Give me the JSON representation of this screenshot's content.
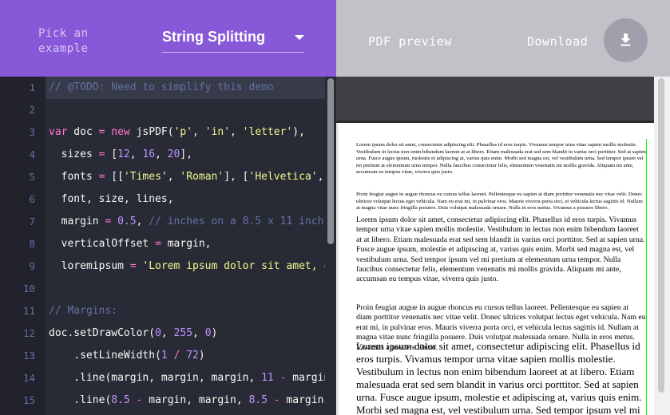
{
  "header": {
    "pick_label": "Pick an\nexample",
    "selected_example": "String Splitting",
    "preview_label": "PDF preview",
    "download_label": "Download"
  },
  "icons": {
    "select_arrow": "triangle-down-icon",
    "download": "download-arrow-icon"
  },
  "colors": {
    "accent_purple": "#8759d8",
    "preview_header": "#c4c0c8",
    "editor_bg": "#282a36",
    "pdf_margin_line": "#00ff00"
  },
  "editor": {
    "line_numbers": [
      "1",
      "2",
      "3",
      "4",
      "5",
      "6",
      "7",
      "8",
      "9",
      "10",
      "11",
      "12",
      "13",
      "14",
      "15"
    ],
    "lines": [
      [
        {
          "t": "comment",
          "v": "// @TODO: Need to simplify this demo"
        }
      ],
      [],
      [
        {
          "t": "kw",
          "v": "var"
        },
        {
          "t": "txt",
          "v": " doc "
        },
        {
          "t": "kw",
          "v": "="
        },
        {
          "t": "txt",
          "v": " "
        },
        {
          "t": "kw",
          "v": "new"
        },
        {
          "t": "txt",
          "v": " jsPDF("
        },
        {
          "t": "str",
          "v": "'p'"
        },
        {
          "t": "txt",
          "v": ", "
        },
        {
          "t": "str",
          "v": "'in'"
        },
        {
          "t": "txt",
          "v": ", "
        },
        {
          "t": "str",
          "v": "'letter'"
        },
        {
          "t": "txt",
          "v": "),"
        }
      ],
      [
        {
          "t": "txt",
          "v": "  sizes "
        },
        {
          "t": "kw",
          "v": "="
        },
        {
          "t": "txt",
          "v": " ["
        },
        {
          "t": "num",
          "v": "12"
        },
        {
          "t": "txt",
          "v": ", "
        },
        {
          "t": "num",
          "v": "16"
        },
        {
          "t": "txt",
          "v": ", "
        },
        {
          "t": "num",
          "v": "20"
        },
        {
          "t": "txt",
          "v": "],"
        }
      ],
      [
        {
          "t": "txt",
          "v": "  fonts "
        },
        {
          "t": "kw",
          "v": "="
        },
        {
          "t": "txt",
          "v": " [["
        },
        {
          "t": "str",
          "v": "'Times'"
        },
        {
          "t": "txt",
          "v": ", "
        },
        {
          "t": "str",
          "v": "'Roman'"
        },
        {
          "t": "txt",
          "v": "], ["
        },
        {
          "t": "str",
          "v": "'Helvetica'"
        },
        {
          "t": "txt",
          "v": ", "
        }
      ],
      [
        {
          "t": "txt",
          "v": "  font, size, lines,"
        }
      ],
      [
        {
          "t": "txt",
          "v": "  margin "
        },
        {
          "t": "kw",
          "v": "="
        },
        {
          "t": "txt",
          "v": " "
        },
        {
          "t": "num",
          "v": "0.5"
        },
        {
          "t": "txt",
          "v": ", "
        },
        {
          "t": "comment",
          "v": "// inches on a 8.5 x 11 inch"
        }
      ],
      [
        {
          "t": "txt",
          "v": "  verticalOffset "
        },
        {
          "t": "kw",
          "v": "="
        },
        {
          "t": "txt",
          "v": " margin,"
        }
      ],
      [
        {
          "t": "txt",
          "v": "  loremipsum "
        },
        {
          "t": "kw",
          "v": "="
        },
        {
          "t": "txt",
          "v": " "
        },
        {
          "t": "str",
          "v": "'Lorem ipsum dolor sit amet, c"
        }
      ],
      [],
      [
        {
          "t": "comment",
          "v": "// Margins:"
        }
      ],
      [
        {
          "t": "txt",
          "v": "doc.setDrawColor("
        },
        {
          "t": "num",
          "v": "0"
        },
        {
          "t": "txt",
          "v": ", "
        },
        {
          "t": "num",
          "v": "255"
        },
        {
          "t": "txt",
          "v": ", "
        },
        {
          "t": "num",
          "v": "0"
        },
        {
          "t": "txt",
          "v": ")"
        }
      ],
      [
        {
          "t": "txt",
          "v": "    .setLineWidth("
        },
        {
          "t": "num",
          "v": "1"
        },
        {
          "t": "txt",
          "v": " "
        },
        {
          "t": "kw",
          "v": "/"
        },
        {
          "t": "txt",
          "v": " "
        },
        {
          "t": "num",
          "v": "72"
        },
        {
          "t": "txt",
          "v": ")"
        }
      ],
      [
        {
          "t": "txt",
          "v": "    .line(margin, margin, margin, "
        },
        {
          "t": "num",
          "v": "11"
        },
        {
          "t": "txt",
          "v": " "
        },
        {
          "t": "kw",
          "v": "-"
        },
        {
          "t": "txt",
          "v": " margin"
        }
      ],
      [
        {
          "t": "txt",
          "v": "    .line("
        },
        {
          "t": "num",
          "v": "8.5"
        },
        {
          "t": "txt",
          "v": " "
        },
        {
          "t": "kw",
          "v": "-"
        },
        {
          "t": "txt",
          "v": " margin, margin, "
        },
        {
          "t": "num",
          "v": "8.5"
        },
        {
          "t": "txt",
          "v": " "
        },
        {
          "t": "kw",
          "v": "-"
        },
        {
          "t": "txt",
          "v": " margin,"
        }
      ]
    ]
  },
  "pdf": {
    "p12_a": "Lorem ipsum dolor sit amet, consectetur adipiscing elit. Phasellus id eros turpis. Vivamus tempor urna vitae sapien mollis molestie. Vestibulum in lectus non enim bibendum laoreet at at libero. Etiam malesuada erat sed sem blandit in varius orci porttitor. Sed at sapien urna. Fusce augue ipsum, molestie et adipiscing at, varius quis enim. Morbi sed magna est, vel vestibulum urna. Sed tempor ipsum vel mi pretium at elementum urna tempor. Nulla faucibus consectetur felis, elementum venenatis mi mollis gravida. Aliquam mi ante, accumsan eu tempus vitae, viverra quis justo.",
    "p12_b": "Proin feugiat augue in augue rhoncus eu cursus tellus laoreet. Pellentesque eu sapien at diam porttitor venenatis nec vitae velit. Donec ultrices volutpat lectus eget vehicula. Nam eu erat mi, in pulvinar eros. Mauris viverra porta orci, et vehicula lectus sagittis id. Nullam at magna vitae nunc fringilla posuere. Duis volutpat malesuada ornare. Nulla in eros metus. Vivamus a posuere libero.",
    "p16_a": "Lorem ipsum dolor sit amet, consectetur adipiscing elit. Phasellus id eros turpis. Vivamus tempor urna vitae sapien mollis molestie. Vestibulum in lectus non enim bibendum laoreet at at libero. Etiam malesuada erat sed sem blandit in varius orci porttitor. Sed at sapien urna. Fusce augue ipsum, molestie et adipiscing at, varius quis enim. Morbi sed magna est, vel vestibulum urna. Sed tempor ipsum vel mi pretium at elementum urna tempor. Nulla faucibus consectetur felis, elementum venenatis mi mollis gravida. Aliquam mi ante, accumsan eu tempus vitae, viverra quis justo.",
    "p16_b": "Proin feugiat augue in augue rhoncus eu cursus tellus laoreet. Pellentesque eu sapien at diam porttitor venenatis nec vitae velit. Donec ultrices volutpat lectus eget vehicula. Nam eu erat mi, in pulvinar eros. Mauris viverra porta orci, et vehicula lectus sagittis id. Nullam at magna vitae nunc fringilla posuere. Duis volutpat malesuada ornare. Nulla in eros metus. Vivamus a posuere libero.",
    "p20_a": "Lorem ipsum dolor sit amet, consectetur adipiscing elit. Phasellus id eros turpis. Vivamus tempor urna vitae sapien mollis molestie. Vestibulum in lectus non enim bibendum laoreet at at libero. Etiam malesuada erat sed sem blandit in varius orci porttitor. Sed at sapien urna. Fusce augue ipsum, molestie et adipiscing at, varius quis enim. Morbi sed magna est, vel vestibulum urna. Sed tempor ipsum vel mi pretium at elementum urna tempor."
  }
}
